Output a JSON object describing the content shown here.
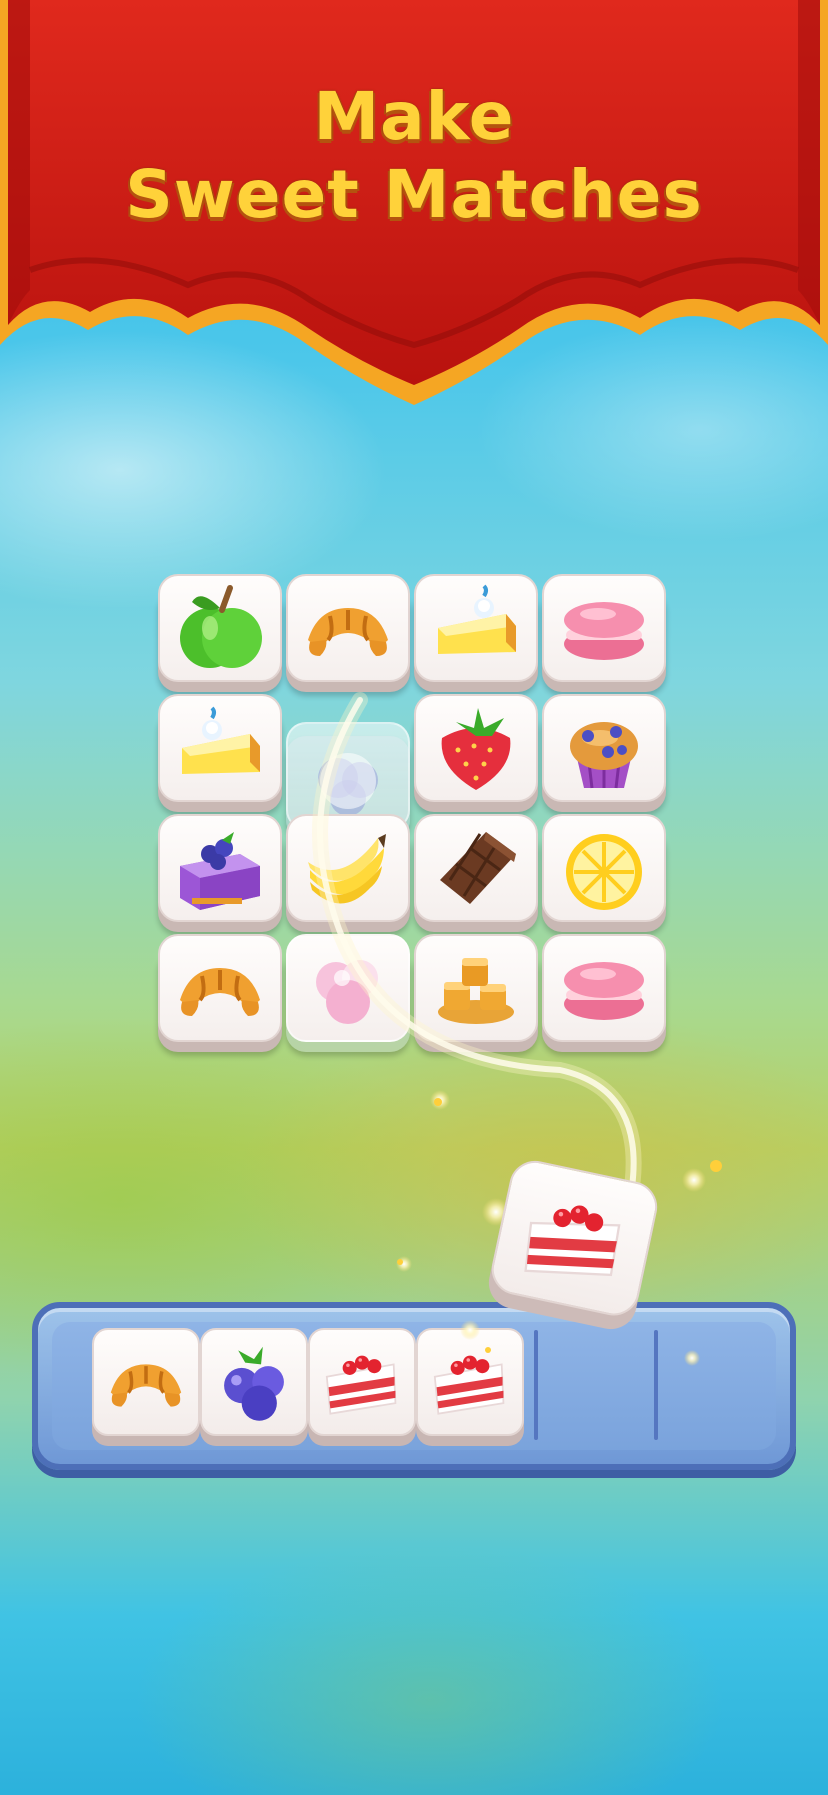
{
  "header": {
    "title_line1": "Make",
    "title_line2": "Sweet Matches",
    "banner_color": "#d4231c",
    "banner_trim": "#f5a623"
  },
  "board": {
    "rows": [
      [
        "apple",
        "croissant",
        "cake-slice",
        "macaron"
      ],
      [
        "cake-slice",
        "blueberry-faded",
        "strawberry",
        "cupcake"
      ],
      [
        "berry-cake",
        "banana",
        "chocolate",
        "lemon"
      ],
      [
        "croissant",
        "marshmallow",
        "caramel",
        "macaron"
      ]
    ]
  },
  "tray": {
    "slots": [
      "croissant",
      "blueberries",
      "strawberry-cake",
      "strawberry-cake",
      "",
      "",
      ""
    ]
  },
  "flying_tile": "strawberry-cake"
}
